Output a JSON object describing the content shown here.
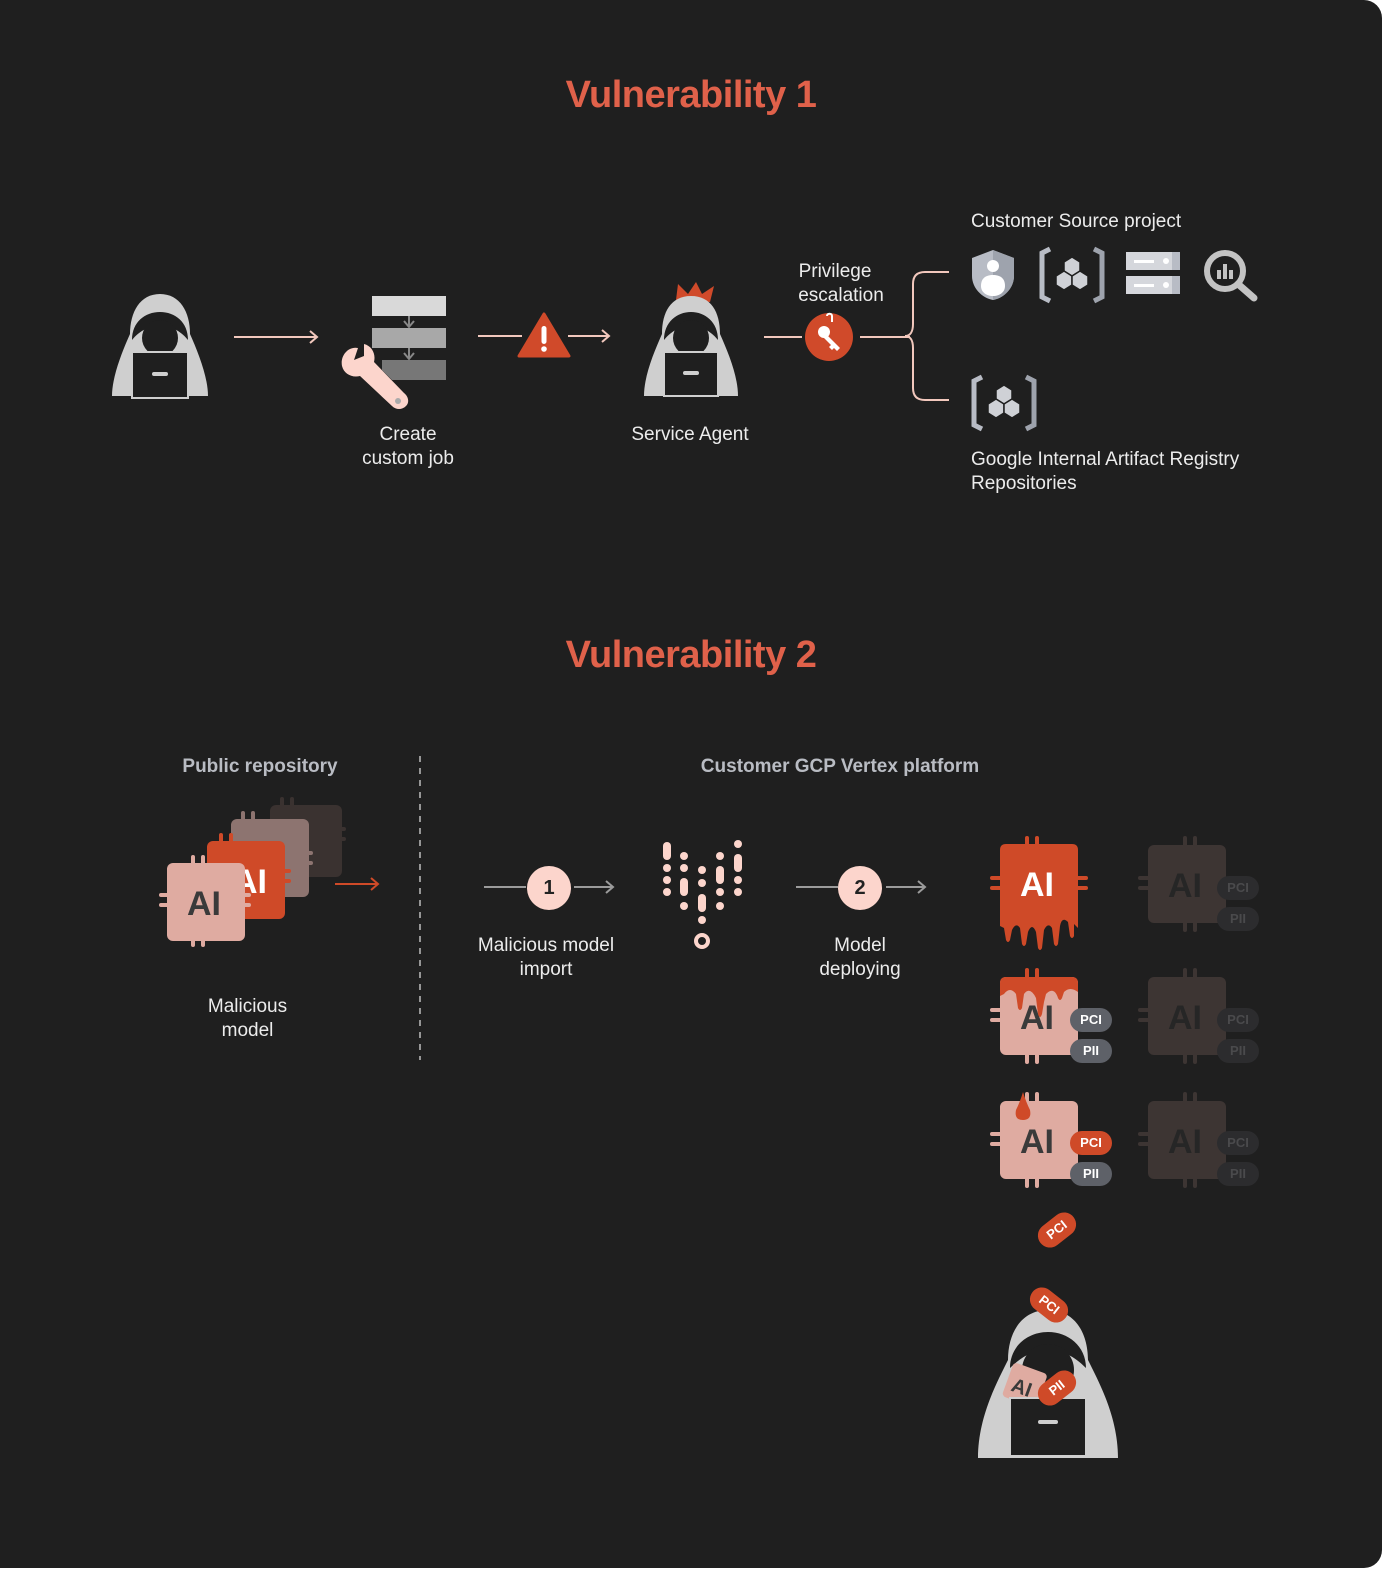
{
  "colors": {
    "background": "#1f1f1f",
    "accent": "#e0614a",
    "accent_dark": "#c94a2c",
    "pink": "#fcd5cc",
    "gray_light": "#cfcfcf",
    "text": "#ececec",
    "muted": "#b9bcc3"
  },
  "vuln1": {
    "title": "Vulnerability 1",
    "steps": [
      {
        "icon": "hacker-icon",
        "label": ""
      },
      {
        "icon": "custom-job-icon",
        "label_line1": "Create",
        "label_line2": "custom job"
      },
      {
        "icon": "warning-icon",
        "label": ""
      },
      {
        "icon": "service-agent-icon",
        "label": "Service Agent"
      },
      {
        "icon": "key-icon",
        "label_line1": "Privilege",
        "label_line2": "escalation"
      }
    ],
    "targets": {
      "customer_source": {
        "label": "Customer Source project",
        "icons": [
          "iam-shield-icon",
          "artifact-registry-icon",
          "storage-server-icon",
          "bigquery-icon"
        ]
      },
      "google_internal": {
        "label_line1": "Google Internal Artifact Registry",
        "label_line2": "Repositories",
        "icons": [
          "artifact-registry-icon"
        ]
      }
    }
  },
  "vuln2": {
    "title": "Vulnerability 2",
    "public_repo": {
      "heading": "Public repository",
      "chip_text": "AI",
      "label_line1": "Malicious",
      "label_line2": "model"
    },
    "platform": {
      "heading": "Customer GCP Vertex platform",
      "step1": {
        "number": "1",
        "label_line1": "Malicious model",
        "label_line2": "import"
      },
      "step2": {
        "number": "2",
        "label_line1": "Model",
        "label_line2": "deploying"
      }
    },
    "deployed_models": [
      {
        "chip": "AI",
        "state": "infected",
        "tags": []
      },
      {
        "chip": "AI",
        "state": "inactive",
        "tags": [
          "PCI",
          "PII"
        ]
      },
      {
        "chip": "AI",
        "state": "infecting",
        "tags": [
          "PCI",
          "PII"
        ]
      },
      {
        "chip": "AI",
        "state": "inactive",
        "tags": [
          "PCI",
          "PII"
        ]
      },
      {
        "chip": "AI",
        "state": "leaking",
        "tags": [
          "PCI",
          "PII"
        ]
      },
      {
        "chip": "AI",
        "state": "inactive",
        "tags": [
          "PCI",
          "PII"
        ]
      }
    ],
    "exfiltrated": {
      "falling_tag": "PCI",
      "attacker_tags": [
        "PCI",
        "AI",
        "PII"
      ]
    }
  }
}
